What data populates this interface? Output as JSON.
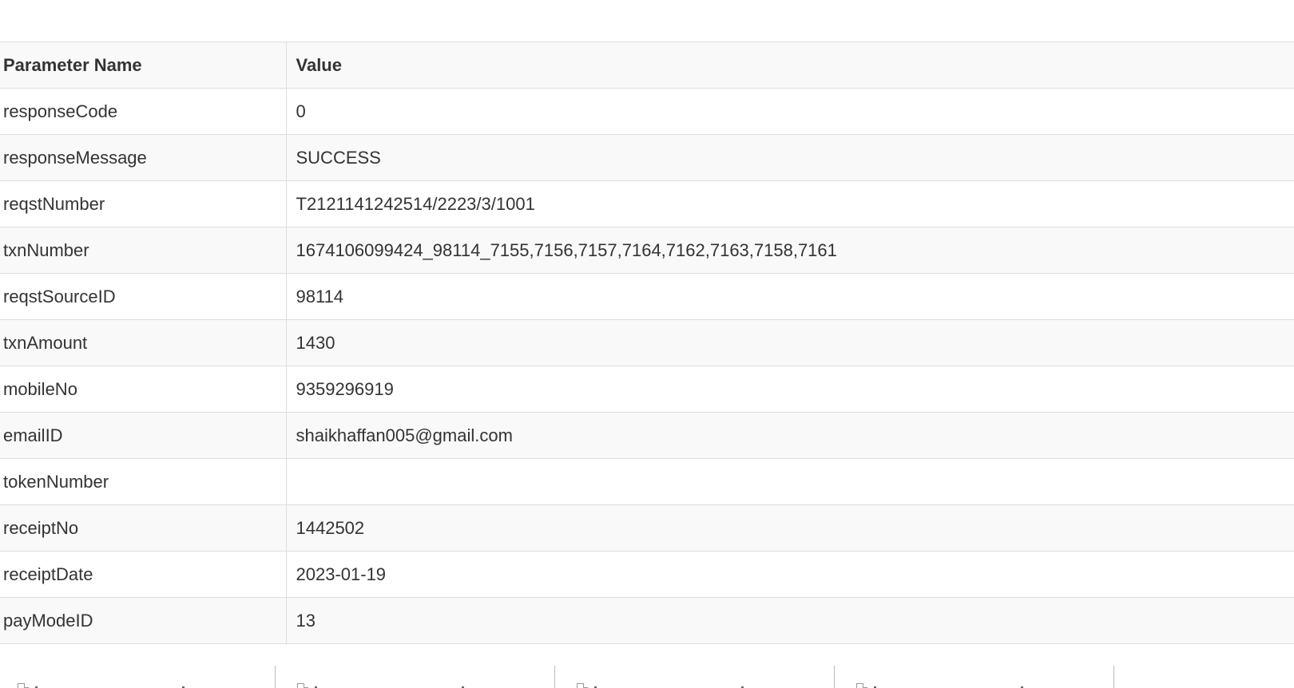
{
  "table": {
    "headers": [
      "Parameter Name",
      "Value"
    ],
    "rows": [
      {
        "name": "responseCode",
        "value": "0"
      },
      {
        "name": "responseMessage",
        "value": "SUCCESS"
      },
      {
        "name": "reqstNumber",
        "value": "T2121141242514/2223/3/1001"
      },
      {
        "name": "txnNumber",
        "value": "1674106099424_98114_7155,7156,7157,7164,7162,7163,7158,7161"
      },
      {
        "name": "reqstSourceID",
        "value": "98114"
      },
      {
        "name": "txnAmount",
        "value": "1430"
      },
      {
        "name": "mobileNo",
        "value": "9359296919"
      },
      {
        "name": "emailID",
        "value": "shaikhaffan005@gmail.com"
      },
      {
        "name": "tokenNumber",
        "value": ""
      },
      {
        "name": "receiptNo",
        "value": "1442502"
      },
      {
        "name": "receiptDate",
        "value": "2023-01-19"
      },
      {
        "name": "payModeID",
        "value": "13"
      }
    ]
  },
  "thumbnails": {
    "icon": "document-icon",
    "count": 4
  },
  "colors": {
    "border": "#dddddd",
    "stripe": "#f9f9f9",
    "text": "#333333"
  }
}
